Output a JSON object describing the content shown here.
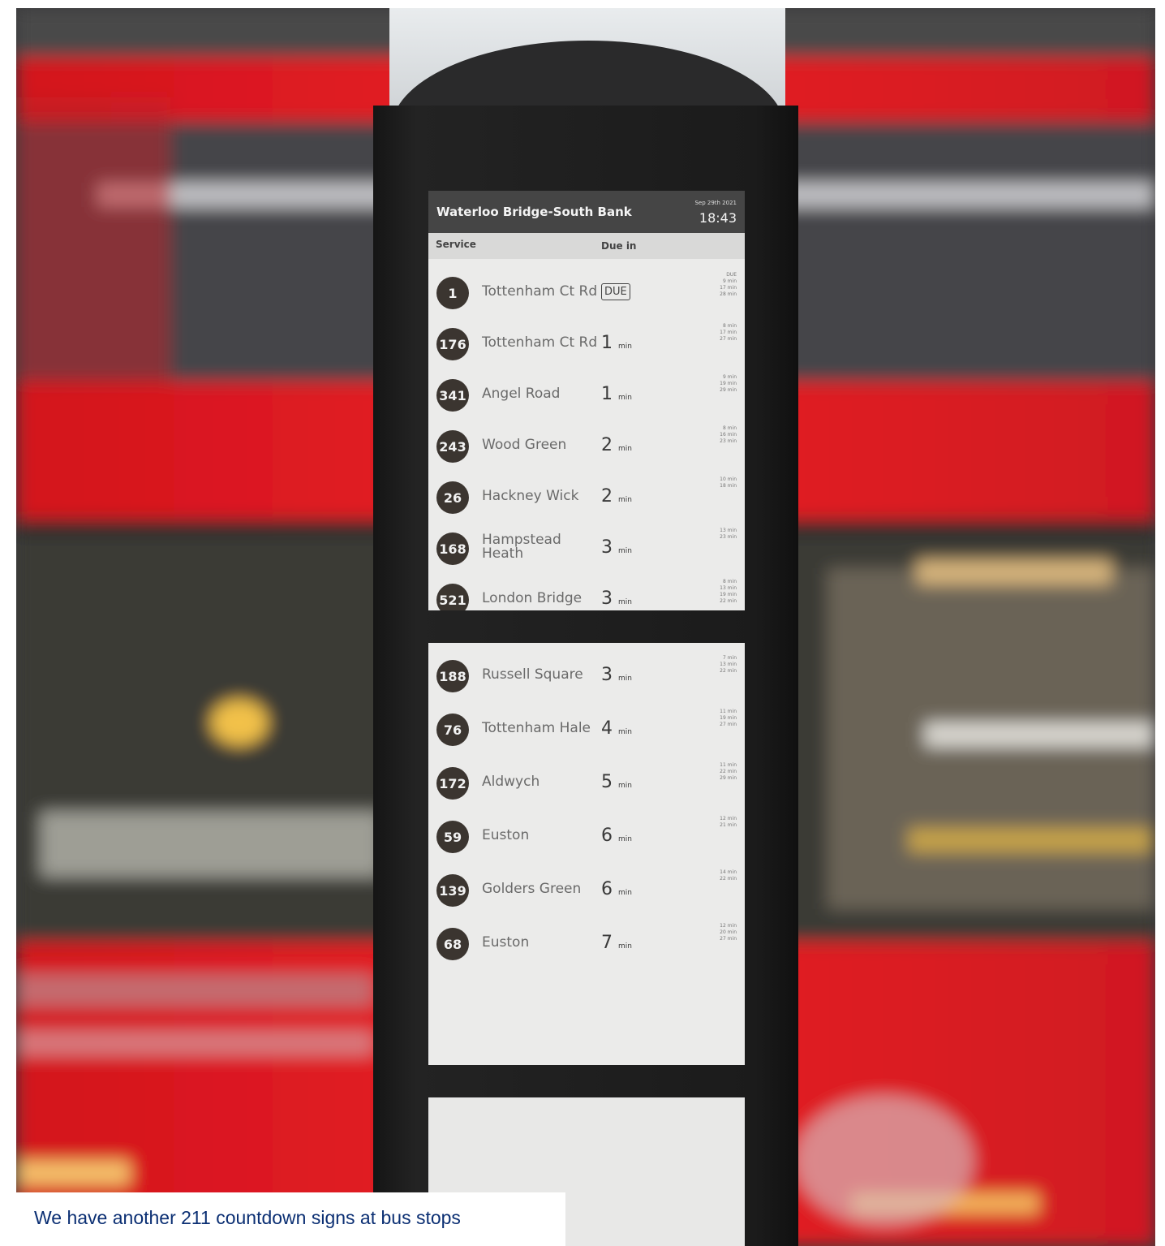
{
  "photo": {
    "subject": "bus-countdown-sign-photo"
  },
  "sign": {
    "stop_name": "Waterloo Bridge-South Bank",
    "date": "Sep 29th 2021",
    "time": "18:43",
    "col_service": "Service",
    "col_due": "Due in",
    "min_unit": "min",
    "rows_top": [
      {
        "route": "1",
        "destination": "Tottenham Ct Rd",
        "due": "DUE",
        "later": [
          "DUE",
          "9 min",
          "17 min",
          "28 min"
        ]
      },
      {
        "route": "176",
        "destination": "Tottenham Ct Rd",
        "due": "1",
        "later": [
          "8 min",
          "17 min",
          "27 min"
        ]
      },
      {
        "route": "341",
        "destination": "Angel Road",
        "due": "1",
        "later": [
          "9 min",
          "19 min",
          "29 min"
        ]
      },
      {
        "route": "243",
        "destination": "Wood Green",
        "due": "2",
        "later": [
          "8 min",
          "16 min",
          "23 min"
        ]
      },
      {
        "route": "26",
        "destination": "Hackney Wick",
        "due": "2",
        "later": [
          "10 min",
          "18 min"
        ]
      },
      {
        "route": "168",
        "destination": "Hampstead Heath",
        "due": "3",
        "later": [
          "13 min",
          "23 min"
        ]
      },
      {
        "route": "521",
        "destination": "London Bridge",
        "due": "3",
        "later": [
          "8 min",
          "13 min",
          "19 min",
          "22 min"
        ]
      }
    ],
    "rows_bottom": [
      {
        "route": "188",
        "destination": "Russell Square",
        "due": "3",
        "later": [
          "7 min",
          "13 min",
          "22 min"
        ]
      },
      {
        "route": "76",
        "destination": "Tottenham Hale",
        "due": "4",
        "later": [
          "11 min",
          "19 min",
          "27 min"
        ]
      },
      {
        "route": "172",
        "destination": "Aldwych",
        "due": "5",
        "later": [
          "11 min",
          "22 min",
          "29 min"
        ]
      },
      {
        "route": "59",
        "destination": "Euston",
        "due": "6",
        "later": [
          "12 min",
          "21 min"
        ]
      },
      {
        "route": "139",
        "destination": "Golders Green",
        "due": "6",
        "later": [
          "14 min",
          "22 min"
        ]
      },
      {
        "route": "68",
        "destination": "Euston",
        "due": "7",
        "later": [
          "12 min",
          "20 min",
          "27 min"
        ]
      }
    ]
  },
  "caption": {
    "text": "We have another 211 countdown signs at bus stops"
  },
  "colors": {
    "bus_red": "#e01b22",
    "caption_text": "#0b2f73",
    "sign_screen": "#ebebea"
  }
}
